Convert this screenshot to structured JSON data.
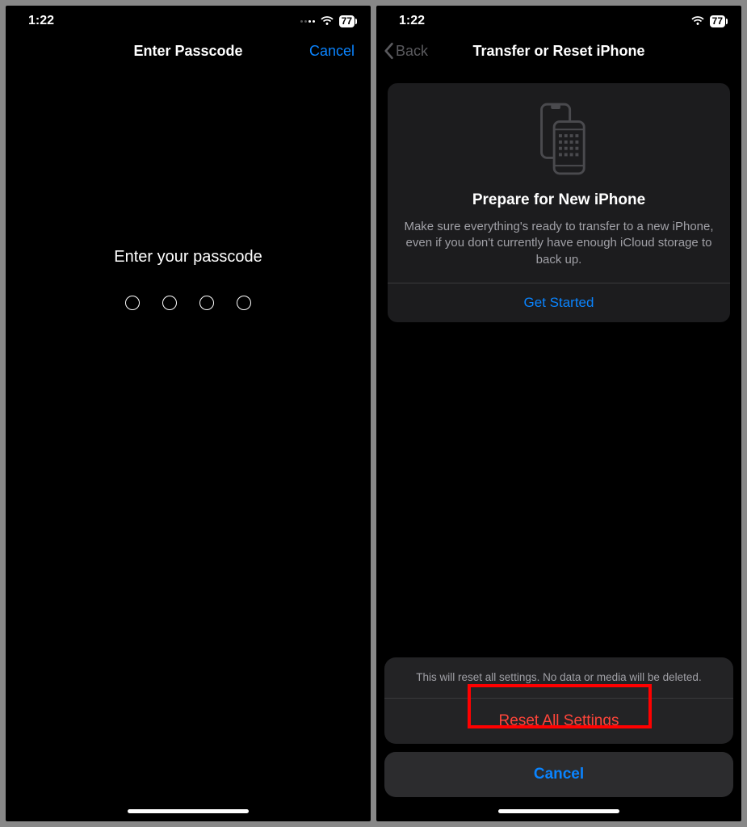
{
  "statusBar": {
    "time": "1:22",
    "battery": "77"
  },
  "left": {
    "navTitle": "Enter Passcode",
    "cancelLabel": "Cancel",
    "prompt": "Enter your passcode"
  },
  "right": {
    "backLabel": "Back",
    "navTitle": "Transfer or Reset iPhone",
    "card": {
      "title": "Prepare for New iPhone",
      "desc": "Make sure everything's ready to transfer to a new iPhone, even if you don't currently have enough iCloud storage to back up.",
      "action": "Get Started"
    },
    "sheet": {
      "message": "This will reset all settings. No data or media will be deleted.",
      "resetLabel": "Reset All Settings",
      "cancelLabel": "Cancel"
    }
  }
}
